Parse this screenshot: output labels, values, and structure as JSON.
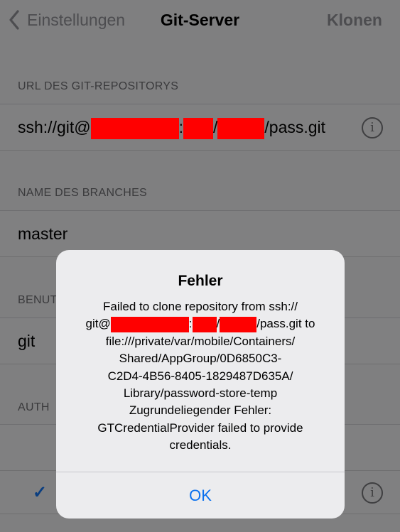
{
  "nav": {
    "back_label": "Einstellungen",
    "title": "Git-Server",
    "action_label": "Klonen"
  },
  "sections": {
    "repo_url_header": "URL DES GIT-REPOSITORYS",
    "repo_url_parts": [
      "ssh://git@",
      ":",
      "/",
      "/pass.git"
    ],
    "branch_header": "NAME DES BRANCHES",
    "branch_value": "master",
    "user_header_visible": "BENUT",
    "user_value": "git",
    "auth_header_visible": "AUTH"
  },
  "alert": {
    "title": "Fehler",
    "message_lines": [
      "Failed to clone repository from ssh://",
      "git@",
      ":",
      "/",
      "/pass.git to",
      "file:///private/var/mobile/Containers/",
      "Shared/AppGroup/0D6850C3-",
      "C2D4-4B56-8405-1829487D635A/",
      "Library/password-store-temp",
      "Zugrundeliegender Fehler:",
      "GTCredentialProvider failed to provide",
      "credentials."
    ],
    "ok_label": "OK"
  },
  "icons": {
    "back": "chevron-left-icon",
    "info": "info-icon",
    "check": "checkmark-icon"
  },
  "colors": {
    "dim_background": "#7f7f80",
    "alert_background": "#ececee",
    "accent": "#0a70ee",
    "redaction": "#ff0000"
  }
}
